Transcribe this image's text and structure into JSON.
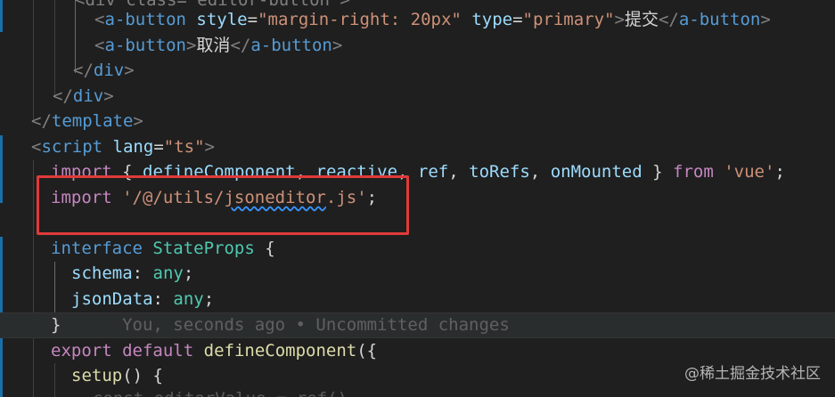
{
  "code": {
    "l0": {
      "a": "<div class=\"editor-button\">"
    },
    "l1": {
      "tag_open": "<",
      "tag": "a-button",
      "attr1": "style",
      "eq": "=",
      "val1": "\"margin-right: 20px\"",
      "attr2": "type",
      "val2": "\"primary\"",
      "gt": ">",
      "text": "提交",
      "close_open": "</",
      "close_tag": "a-button",
      "close_gt": ">"
    },
    "l2": {
      "tag_open": "<",
      "tag": "a-button",
      "gt": ">",
      "text": "取消",
      "close_open": "</",
      "close_tag": "a-button",
      "close_gt": ">"
    },
    "l3": {
      "open": "</",
      "tag": "div",
      "gt": ">"
    },
    "l4": {
      "open": "</",
      "tag": "div",
      "gt": ">"
    },
    "l5": {
      "open": "</",
      "tag": "template",
      "gt": ">"
    },
    "l6": {
      "open": "<",
      "tag": "script",
      "attr": "lang",
      "eq": "=",
      "val": "\"ts\"",
      "gt": ">"
    },
    "l7": {
      "import": "import",
      "b1": "{",
      "p1": "defineComponent",
      "c1": ",",
      "p2": "reactive",
      "c2": ",",
      "p3": "ref",
      "c3": ",",
      "p4": "toRefs",
      "c4": ",",
      "p5": "onMounted",
      "b2": "}",
      "from": "from",
      "mod": "'vue'",
      "semi": ";"
    },
    "l8": {
      "import": "import",
      "q1": "'/@/utils/",
      "squig": "jsoneditor",
      "q2": ".js'",
      "semi": ";"
    },
    "l10": {
      "kw": "interface",
      "name": "StateProps",
      "brace": "{"
    },
    "l11": {
      "prop": "schema",
      "colon": ":",
      "type": "any",
      "semi": ";"
    },
    "l12": {
      "prop": "jsonData",
      "colon": ":",
      "type": "any",
      "semi": ";"
    },
    "l13": {
      "brace": "}",
      "blame": "You, seconds ago • Uncommitted changes"
    },
    "l14": {
      "export": "export",
      "default": "default",
      "fn": "defineComponent",
      "paren": "({"
    },
    "l15": {
      "fn": "setup",
      "paren": "()",
      "brace": "{"
    },
    "l16": {
      "a": "const editorValue = ref()"
    }
  },
  "watermark": "@稀土掘金技术社区",
  "colors": {
    "background": "#1f1f1f",
    "highlight_box": "#e03a3a",
    "keyword": "#569cd6",
    "control_keyword": "#c586c0",
    "string": "#ce9178",
    "type": "#4ec9b0",
    "function": "#dcdcaa",
    "variable": "#9cdcfe"
  }
}
